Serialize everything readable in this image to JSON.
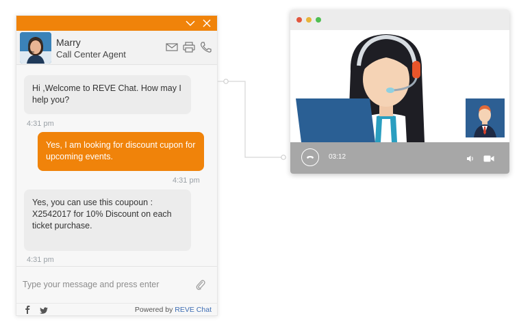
{
  "chat": {
    "agent_name": "Marry",
    "agent_role": "Call Center Agent",
    "messages": [
      {
        "sender": "agent",
        "text": "Hi ,Welcome to REVE Chat. How may I help you?",
        "time": "4:31 pm"
      },
      {
        "sender": "user",
        "text": "Yes, I am looking for discount cupon for upcoming events.",
        "time": "4:31 pm"
      },
      {
        "sender": "agent",
        "text": "Yes, you can use this coupoun : X2542017 for 10% Discount on each ticket purchase.",
        "time": "4:31 pm"
      }
    ],
    "composer_placeholder": "Type your message and press enter",
    "powered_by": "Powered by",
    "brand": "REVE Chat"
  },
  "video_call": {
    "timer": "03:12"
  },
  "colors": {
    "accent": "#f0830a",
    "agent_bubble": "#ececec",
    "control_bar": "#a7a7a7",
    "brand_link": "#3d6db3"
  },
  "icons": [
    "chevron-down-icon",
    "close-icon",
    "mail-icon",
    "print-icon",
    "phone-icon",
    "attachment-icon",
    "facebook-icon",
    "twitter-icon",
    "end-call-icon",
    "volume-icon",
    "video-camera-icon"
  ]
}
